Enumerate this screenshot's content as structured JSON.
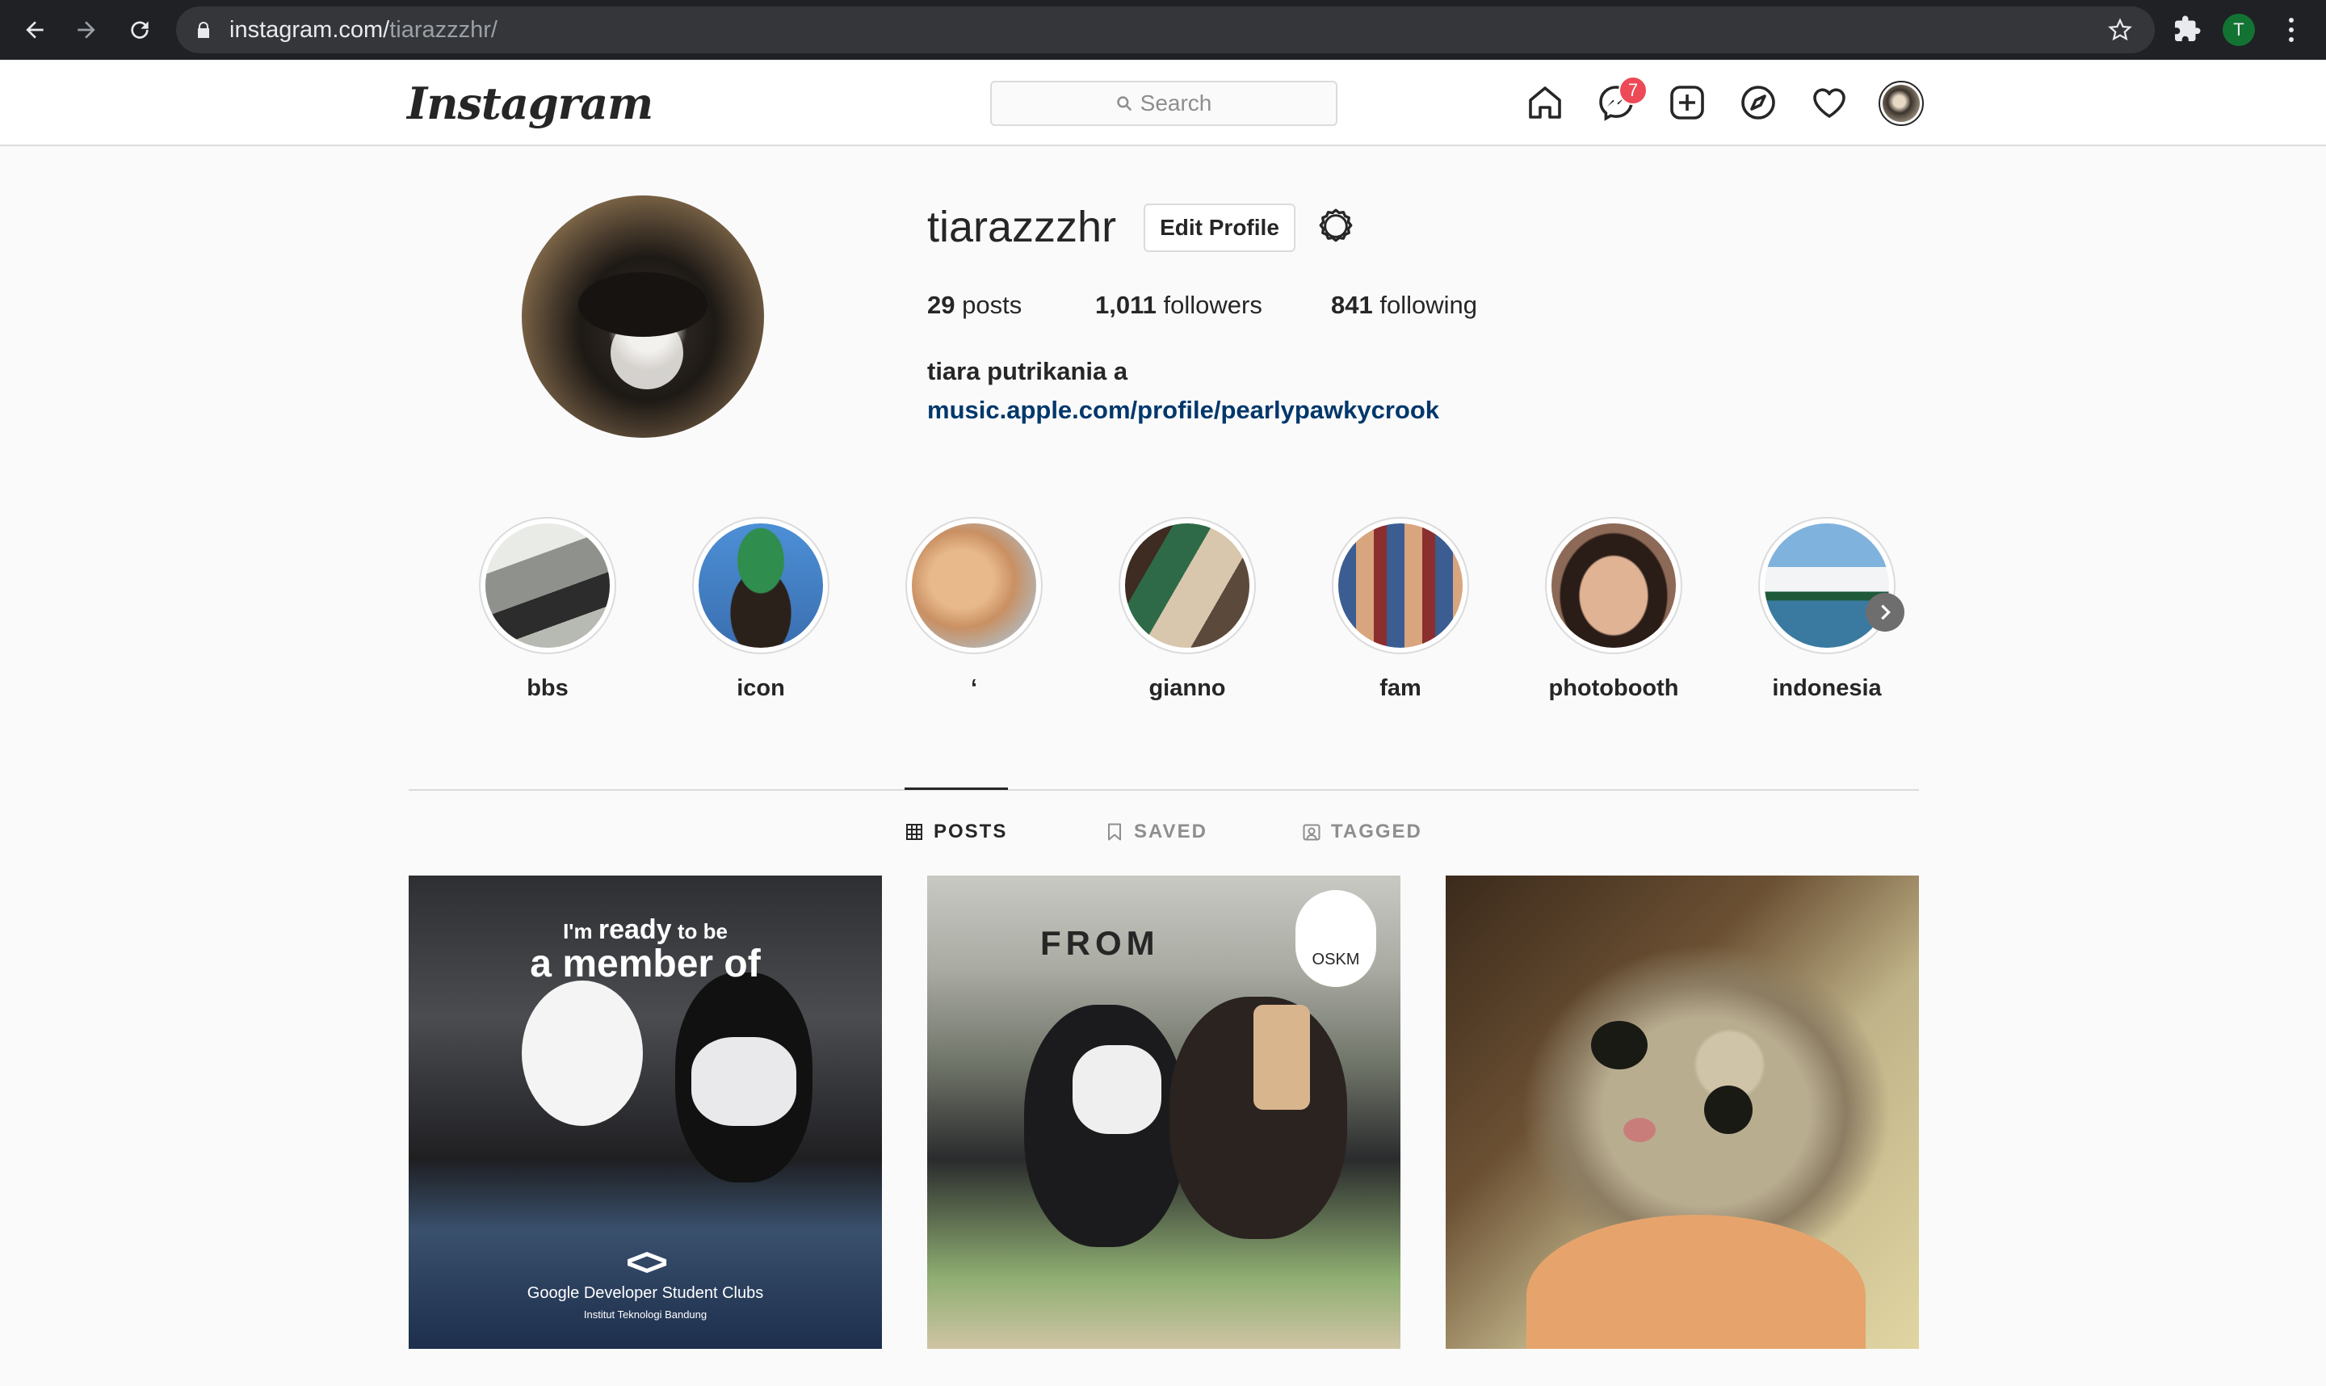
{
  "browser": {
    "url_host": "instagram.com/",
    "url_path": "tiarazzzhr/",
    "profile_initial": "T"
  },
  "header": {
    "logo": "Instagram",
    "search_placeholder": "Search",
    "messenger_badge": "7"
  },
  "profile": {
    "username": "tiarazzzhr",
    "edit_button": "Edit Profile",
    "stats": [
      {
        "count": "29",
        "label": "posts"
      },
      {
        "count": "1,011",
        "label": "followers"
      },
      {
        "count": "841",
        "label": "following"
      }
    ],
    "full_name": "tiara putrikania a",
    "link": "music.apple.com/profile/pearlypawkycrook"
  },
  "highlights": [
    {
      "label": "bbs",
      "color": "#8f928c"
    },
    {
      "label": "icon",
      "color": "#3a6fb0"
    },
    {
      "label": "‘",
      "color": "#c9a27c"
    },
    {
      "label": "gianno",
      "color": "#5b4a3b"
    },
    {
      "label": "fam",
      "color": "#3b5d92"
    },
    {
      "label": "photobooth",
      "color": "#8d6a57"
    },
    {
      "label": "indonesia",
      "color": "#7fb2dc"
    }
  ],
  "tabs": [
    {
      "label": "POSTS",
      "icon": "grid-icon",
      "active": true
    },
    {
      "label": "SAVED",
      "icon": "bookmark-icon",
      "active": false
    },
    {
      "label": "TAGGED",
      "icon": "tagged-icon",
      "active": false
    }
  ],
  "posts": [
    {
      "line1_small": "I'm",
      "line1_big": "ready",
      "line1_tail": "to be",
      "line2": "a member of",
      "caption": "Google Developer Student Clubs",
      "subcaption": "Institut Teknologi Bandung"
    },
    {
      "sign_text": "FROM",
      "badge": "OSKM"
    },
    {}
  ]
}
